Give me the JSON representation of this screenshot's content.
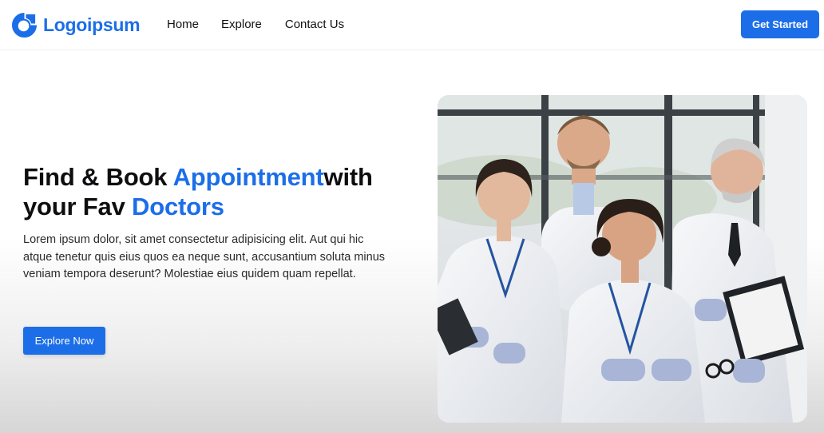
{
  "brand": {
    "name": "Logoipsum",
    "color": "#1c6ee8"
  },
  "nav": {
    "links": [
      "Home",
      "Explore",
      "Contact Us"
    ],
    "cta_label": "Get Started"
  },
  "hero": {
    "title_part1": "Find & Book ",
    "title_accent1": "Appointment",
    "title_part2": "with your Fav ",
    "title_accent2": "Doctors",
    "description": "Lorem ipsum dolor, sit amet consectetur adipisicing elit. Aut qui hic atque tenetur quis eius quos ea neque sunt, accusantium soluta minus veniam tempora deserunt? Molestiae eius quidem quam repellat.",
    "cta_label": "Explore Now",
    "image_subject": "group of four smiling doctors in white lab coats"
  },
  "colors": {
    "accent": "#1c6ee8",
    "text": "#111111"
  }
}
